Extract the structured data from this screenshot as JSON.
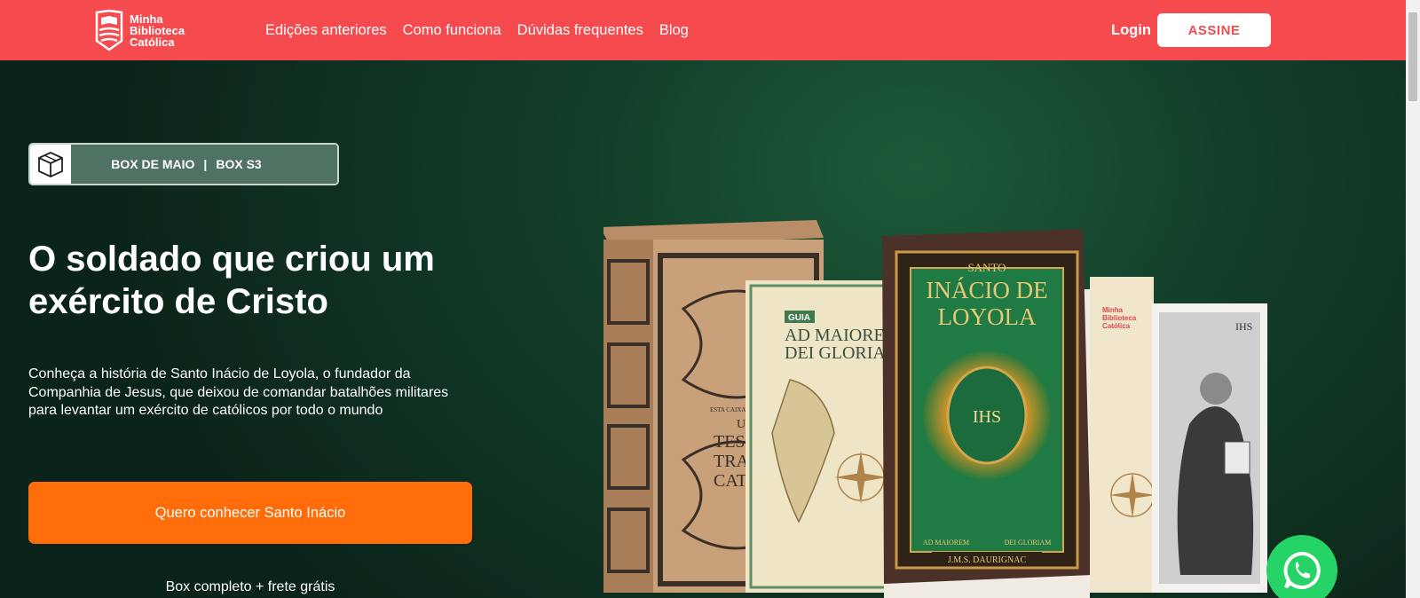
{
  "header": {
    "logo_lines": [
      "Minha",
      "Biblioteca",
      "Católica"
    ],
    "nav": [
      "Edições anteriores",
      "Como funciona",
      "Dúvidas frequentes",
      "Blog"
    ],
    "login_label": "Login",
    "subscribe_label": "ASSINE"
  },
  "hero": {
    "badge": {
      "box_label": "BOX DE MAIO",
      "separator": "|",
      "series_label": "BOX S3"
    },
    "title": "O soldado que criou um exército de Cristo",
    "description": "Conheça a história de Santo Inácio de Loyola, o fundador da Companhia de Jesus, que deixou de comandar batalhões militares para levantar um exército de católicos por todo o mundo",
    "cta_label": "Quero conhecer Santo Inácio",
    "subtext": "Box completo + frete grátis"
  },
  "products": {
    "box_text": [
      "ESTA CAIXA C",
      "UM",
      "TESO",
      "TRADI",
      "CATÓ"
    ],
    "guide_book": {
      "tag": "GUIA",
      "title_line1": "AD MAIOREM",
      "title_line2": "DEI GLORIA"
    },
    "main_book": {
      "pretitle": "SANTO",
      "title_line1": "INÁCIO DE",
      "title_line2": "LOYOLA",
      "monogram": "IHS",
      "motto_left": "AD MAIOREM",
      "motto_right": "DEI GLORIAM",
      "author": "J.M.S. DAURIGNAC"
    },
    "notebook_brand": [
      "Minha",
      "Biblioteca",
      "Católica"
    ],
    "portrait_monogram": "IHS"
  },
  "colors": {
    "header_bg": "#f54b4f",
    "cta_bg": "#ff6c0a",
    "hero_bg": "#133f2a",
    "whatsapp": "#25d366"
  },
  "icons": [
    "logo-icon",
    "box-icon",
    "whatsapp-icon"
  ]
}
